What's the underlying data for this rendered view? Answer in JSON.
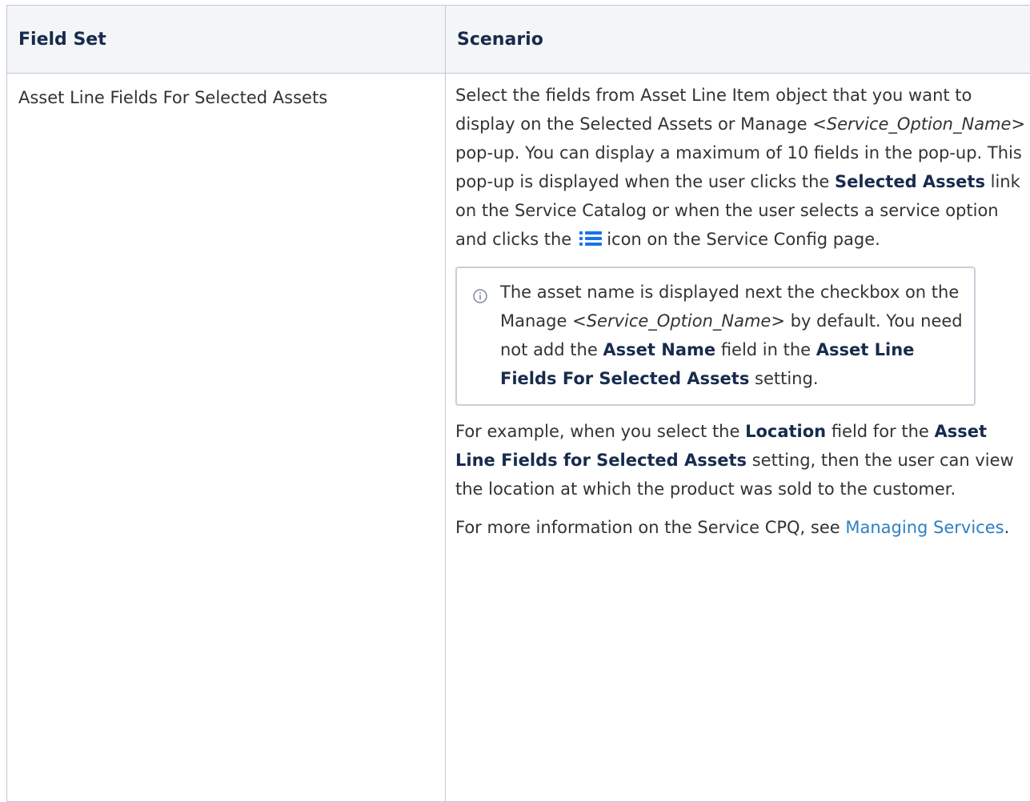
{
  "table": {
    "headers": [
      "Field Set",
      "Scenario"
    ],
    "row": {
      "field_set": "Asset Line Fields For Selected Assets",
      "p1": {
        "t1": "Select the fields from Asset Line Item object that you want to display on the Selected Assets or Manage ",
        "t2_italic": "<Service_Option_Name>",
        "t3": " pop-up. You can display a maximum of 10 fields in the pop-up. This pop-up is displayed when the user clicks the ",
        "t4_bold": "Selected Assets",
        "t5": " link on the Service Catalog or when the user selects a service option and clicks the",
        "icon": "list-icon",
        "t6": "icon on the Service Config page."
      },
      "note": {
        "icon": "info-icon",
        "t1": "The asset name is displayed next the checkbox on the Manage ",
        "t2_italic": "<Service_Option_Name>",
        "t3": " by default. You need not add the ",
        "t4_bold": "Asset Name",
        "t5": " field in the ",
        "t6_bold": "Asset Line Fields For Selected Assets",
        "t7": " setting."
      },
      "p2": {
        "t1": "For example, when you select the ",
        "t2_bold": "Location",
        "t3": " field for the ",
        "t4_bold": "Asset Line Fields for Selected Assets",
        "t5": " setting, then the user can view the location at which the product was sold to the customer."
      },
      "p3": {
        "t1": "For more information on the Service CPQ, see ",
        "link": "Managing Services",
        "t2": "."
      }
    }
  },
  "colors": {
    "header_bg": "#f4f5f7",
    "border": "#c1c7d0",
    "link": "#2f7fc1",
    "icon_blue": "#1a73e8"
  }
}
